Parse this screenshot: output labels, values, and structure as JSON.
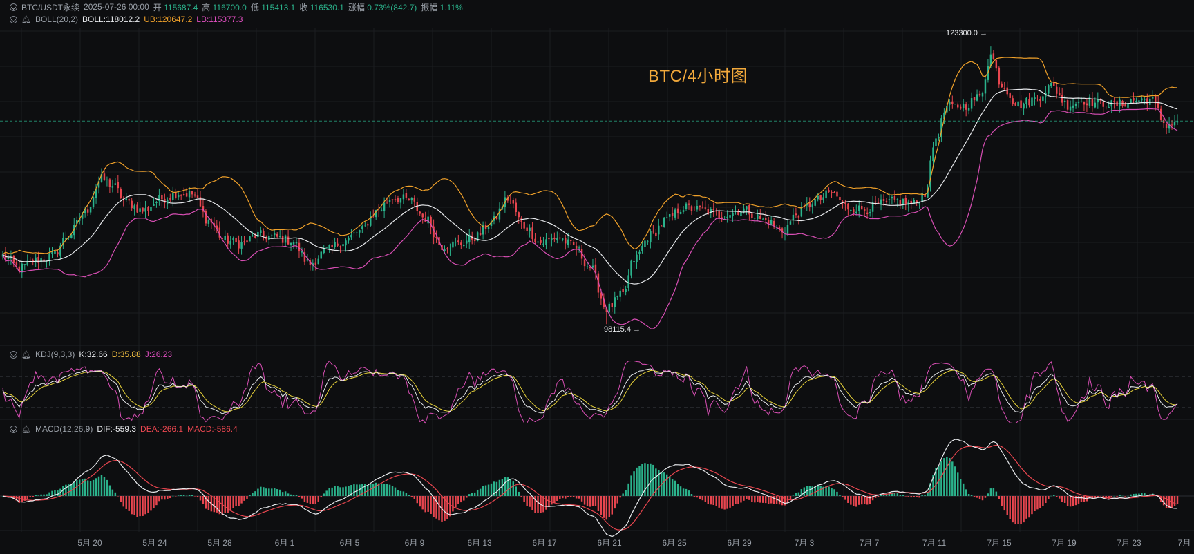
{
  "main_header": {
    "symbol": "BTC/USDT永续",
    "datetime": "2025-07-26 00:00",
    "open_label": "开",
    "open": "115687.4",
    "high_label": "高",
    "high": "116700.0",
    "low_label": "低",
    "low": "115413.1",
    "close_label": "收",
    "close": "116530.1",
    "change_label": "涨幅",
    "change": "0.73%(842.7)",
    "amplitude_label": "振幅",
    "amplitude": "1.11%"
  },
  "boll_header": {
    "name": "BOLL(20,2)",
    "mid": "BOLL:118012.2",
    "ub": "UB:120647.2",
    "lb": "LB:115377.3"
  },
  "kdj_header": {
    "name": "KDJ(9,3,3)",
    "k": "K:32.66",
    "d": "D:35.88",
    "j": "J:26.23"
  },
  "macd_header": {
    "name": "MACD(12,26,9)",
    "dif": "DIF:-559.3",
    "dea": "DEA:-266.1",
    "macd": "MACD:-586.4"
  },
  "watermark": "BTC/4小时图",
  "annotations": {
    "high": "123300.0",
    "low": "98115.4"
  },
  "colors": {
    "bg": "#0d0e10",
    "up": "#2bb38c",
    "down": "#e8464f",
    "boll_mid": "#e8eaed",
    "boll_ub": "#f0a12a",
    "boll_lb": "#d94fb5",
    "kdj_k": "#e8eaed",
    "kdj_d": "#e8d33a",
    "kdj_j": "#d94fb5"
  },
  "icons": [
    "chevron-down-icon",
    "bell-icon"
  ],
  "chart_data": {
    "type": "candlestick",
    "interval": "4h",
    "y_range": [
      96500,
      125000
    ],
    "x_labels": [
      "5月 20",
      "5月 24",
      "5月 28",
      "6月 1",
      "6月 5",
      "6月 9",
      "6月 13",
      "6月 17",
      "6月 21",
      "6月 25",
      "6月 29",
      "7月 3",
      "7月 7",
      "7月 11",
      "7月 15",
      "7月 19",
      "7月 23",
      "7月"
    ],
    "close_anchors": [
      [
        0,
        104300
      ],
      [
        6,
        103200
      ],
      [
        12,
        103900
      ],
      [
        18,
        104300
      ],
      [
        24,
        106200
      ],
      [
        30,
        108300
      ],
      [
        36,
        111300
      ],
      [
        40,
        110700
      ],
      [
        45,
        109200
      ],
      [
        51,
        108400
      ],
      [
        58,
        109500
      ],
      [
        64,
        110000
      ],
      [
        69,
        109900
      ],
      [
        75,
        107500
      ],
      [
        81,
        105700
      ],
      [
        87,
        105400
      ],
      [
        93,
        106200
      ],
      [
        99,
        106000
      ],
      [
        105,
        105700
      ],
      [
        112,
        103600
      ],
      [
        118,
        104800
      ],
      [
        124,
        105600
      ],
      [
        130,
        106500
      ],
      [
        136,
        108300
      ],
      [
        142,
        109600
      ],
      [
        148,
        109400
      ],
      [
        154,
        107700
      ],
      [
        160,
        105200
      ],
      [
        166,
        105400
      ],
      [
        172,
        106000
      ],
      [
        178,
        107300
      ],
      [
        184,
        109500
      ],
      [
        190,
        107000
      ],
      [
        196,
        105500
      ],
      [
        202,
        106000
      ],
      [
        208,
        105200
      ],
      [
        214,
        103300
      ],
      [
        220,
        99500
      ],
      [
        226,
        100800
      ],
      [
        230,
        104000
      ],
      [
        236,
        106200
      ],
      [
        242,
        107600
      ],
      [
        248,
        108700
      ],
      [
        254,
        108500
      ],
      [
        262,
        108000
      ],
      [
        270,
        108500
      ],
      [
        278,
        107500
      ],
      [
        284,
        106600
      ],
      [
        290,
        108200
      ],
      [
        296,
        109300
      ],
      [
        302,
        110000
      ],
      [
        308,
        108700
      ],
      [
        314,
        108500
      ],
      [
        320,
        109000
      ],
      [
        326,
        109300
      ],
      [
        332,
        109000
      ],
      [
        336,
        110000
      ],
      [
        340,
        115000
      ],
      [
        344,
        117800
      ],
      [
        350,
        117900
      ],
      [
        356,
        118700
      ],
      [
        360,
        122500
      ],
      [
        364,
        119800
      ],
      [
        370,
        118000
      ],
      [
        376,
        118500
      ],
      [
        382,
        119700
      ],
      [
        388,
        118000
      ],
      [
        394,
        118400
      ],
      [
        400,
        118100
      ],
      [
        406,
        118000
      ],
      [
        412,
        118400
      ],
      [
        418,
        118500
      ],
      [
        424,
        116200
      ],
      [
        428,
        116530
      ]
    ],
    "extremes": {
      "high": 123300.0,
      "low": 98115.4
    },
    "boll_last": {
      "mid": 118012.2,
      "ub": 120647.2,
      "lb": 115377.3
    },
    "kdj_last": {
      "k": 32.66,
      "d": 35.88,
      "j": 26.23
    },
    "macd_last": {
      "dif": -559.3,
      "dea": -266.1,
      "macd": -586.4
    }
  }
}
